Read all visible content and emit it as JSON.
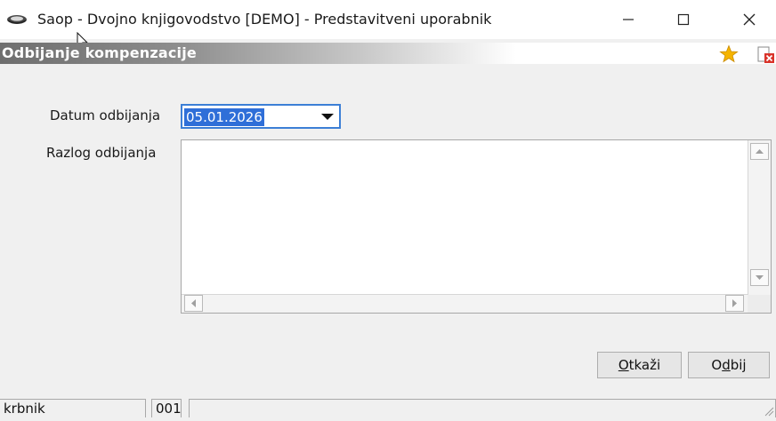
{
  "window": {
    "title": "Saop  - Dvojno knjigovodstvo [DEMO] - Predstavitveni uporabnik",
    "minimize_icon": "minimize-icon",
    "maximize_icon": "maximize-icon",
    "close_icon": "close-icon"
  },
  "header": {
    "title": "Odbijanje kompenzacije",
    "favorite_icon": "star-icon",
    "close_doc_icon": "close-document-icon"
  },
  "form": {
    "date_label": "Datum odbijanja",
    "date_value": "05.01.2026",
    "reason_label": "Razlog odbijanja",
    "reason_value": ""
  },
  "buttons": {
    "cancel_pre": "",
    "cancel_mnemonic": "O",
    "cancel_post": "tkaži",
    "reject_pre": "O",
    "reject_mnemonic": "d",
    "reject_post": "bij"
  },
  "status": {
    "user": "krbnik",
    "code": "001"
  },
  "colors": {
    "selection": "#2f6fd8",
    "focus_border": "#3c7fd6",
    "star": "#f5b400",
    "close_doc": "#d9342b"
  }
}
